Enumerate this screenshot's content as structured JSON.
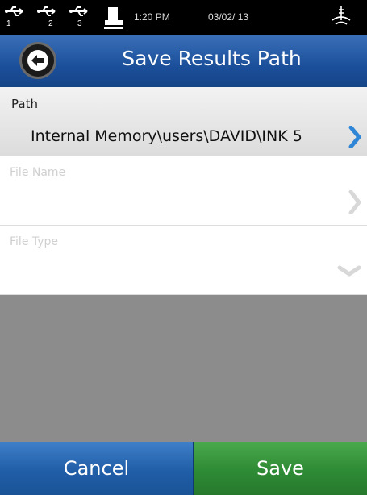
{
  "status_bar": {
    "usb_ports": [
      "1",
      "2",
      "3"
    ],
    "icons": [
      "usb-icon",
      "usb-icon",
      "usb-icon",
      "printer-icon",
      "battery-signal-icon"
    ],
    "time": "1:20 PM",
    "date": "03/02/ 13"
  },
  "header": {
    "title": "Save Results Path",
    "back_icon": "back-arrow-icon",
    "color": "#1b4f9a"
  },
  "path": {
    "label": "Path",
    "value": "Internal Memory\\users\\DAVID\\INK 5",
    "chevron_color": "#2f86d6"
  },
  "file_name": {
    "label": "File Name",
    "value": ""
  },
  "file_type": {
    "label": "File Type",
    "value": ""
  },
  "footer": {
    "cancel_label": "Cancel",
    "save_label": "Save",
    "cancel_color": "#205ea8",
    "save_color": "#2e8b35"
  }
}
